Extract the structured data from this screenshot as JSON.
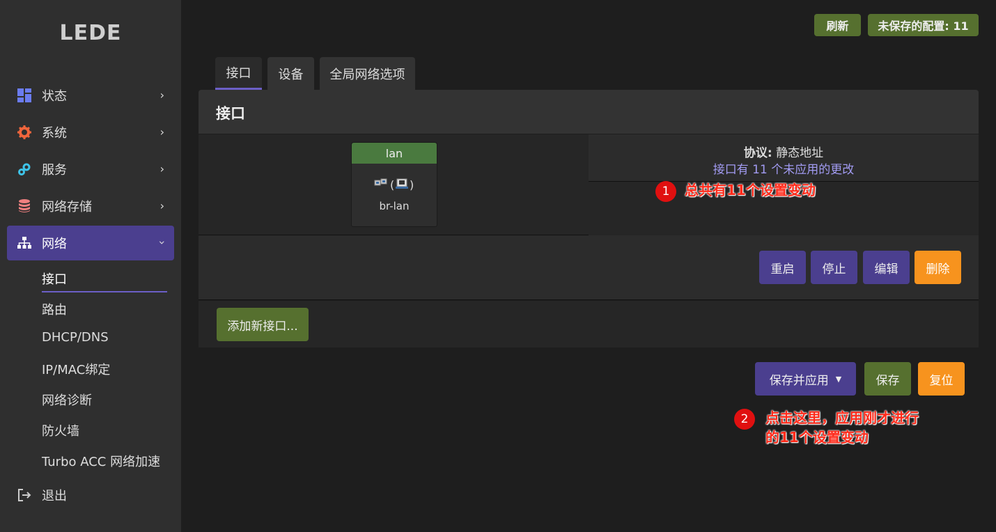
{
  "sidebar": {
    "logo": "LEDE",
    "items": [
      {
        "label": "状态",
        "icon": "dashboard-icon",
        "color": "#6b7cf0"
      },
      {
        "label": "系统",
        "icon": "gear-icon",
        "color": "#f0653c"
      },
      {
        "label": "服务",
        "icon": "gears-icon",
        "color": "#3ec3e8"
      },
      {
        "label": "网络存储",
        "icon": "database-icon",
        "color": "#f08080"
      },
      {
        "label": "网络",
        "icon": "sitemap-icon",
        "color": "#ffffff"
      }
    ],
    "sub_items": [
      "接口",
      "路由",
      "DHCP/DNS",
      "IP/MAC绑定",
      "网络诊断",
      "防火墙",
      "Turbo ACC 网络加速"
    ],
    "logout": "退出"
  },
  "header": {
    "refresh": "刷新",
    "unsaved": "未保存的配置: 11"
  },
  "tabs": [
    "接口",
    "设备",
    "全局网络选项"
  ],
  "panel": {
    "title": "接口",
    "interface": {
      "name": "lan",
      "device": "br-lan",
      "protocol_label": "协议:",
      "protocol_value": "静态地址",
      "changes": "接口有 11 个未应用的更改"
    },
    "actions": [
      "重启",
      "停止",
      "编辑",
      "删除"
    ],
    "add_button": "添加新接口..."
  },
  "footer": {
    "save_apply": "保存并应用",
    "save": "保存",
    "reset": "复位"
  },
  "annotations": [
    {
      "num": "1",
      "text": "总共有11个设置变动"
    },
    {
      "num": "2",
      "line1": "点击这里，应用刚才进行",
      "line2": "的11个设置变动"
    }
  ]
}
